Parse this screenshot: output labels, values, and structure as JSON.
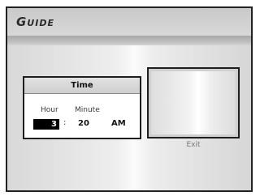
{
  "header": {
    "title": "Guide"
  },
  "time_panel": {
    "title": "Time",
    "hour_label": "Hour",
    "minute_label": "Minute",
    "hour_value": "3",
    "separator": ":",
    "minute_value": "20",
    "ampm_value": "AM"
  },
  "exit": {
    "label": "Exit"
  }
}
